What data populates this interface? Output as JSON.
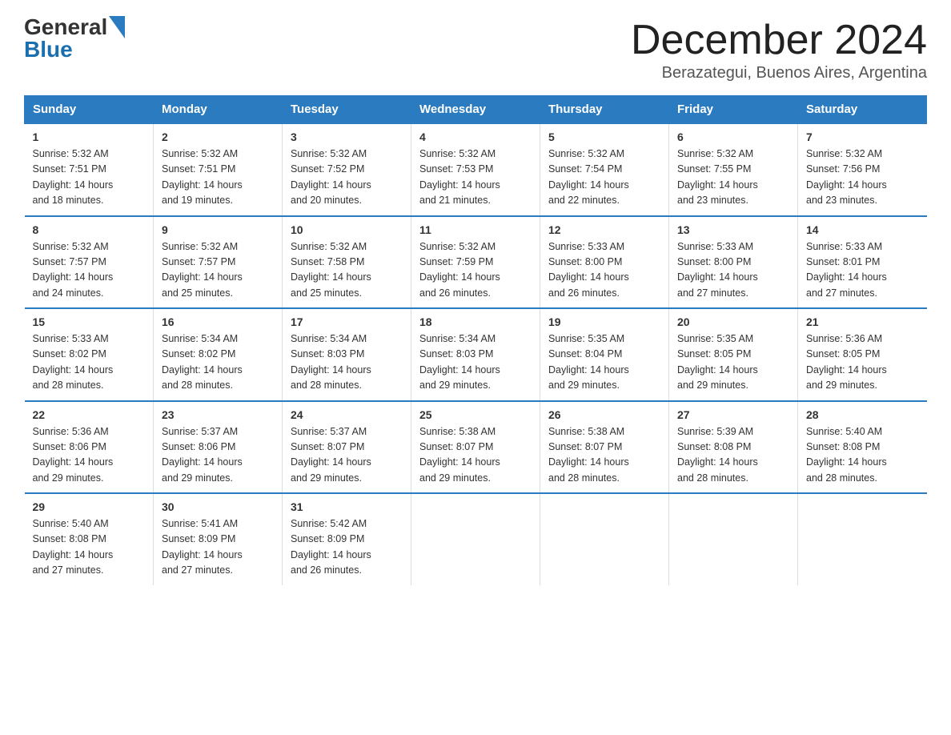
{
  "logo": {
    "general": "General",
    "blue": "Blue"
  },
  "title": "December 2024",
  "subtitle": "Berazategui, Buenos Aires, Argentina",
  "headers": [
    "Sunday",
    "Monday",
    "Tuesday",
    "Wednesday",
    "Thursday",
    "Friday",
    "Saturday"
  ],
  "weeks": [
    [
      {
        "day": "1",
        "sunrise": "5:32 AM",
        "sunset": "7:51 PM",
        "daylight": "14 hours and 18 minutes."
      },
      {
        "day": "2",
        "sunrise": "5:32 AM",
        "sunset": "7:51 PM",
        "daylight": "14 hours and 19 minutes."
      },
      {
        "day": "3",
        "sunrise": "5:32 AM",
        "sunset": "7:52 PM",
        "daylight": "14 hours and 20 minutes."
      },
      {
        "day": "4",
        "sunrise": "5:32 AM",
        "sunset": "7:53 PM",
        "daylight": "14 hours and 21 minutes."
      },
      {
        "day": "5",
        "sunrise": "5:32 AM",
        "sunset": "7:54 PM",
        "daylight": "14 hours and 22 minutes."
      },
      {
        "day": "6",
        "sunrise": "5:32 AM",
        "sunset": "7:55 PM",
        "daylight": "14 hours and 23 minutes."
      },
      {
        "day": "7",
        "sunrise": "5:32 AM",
        "sunset": "7:56 PM",
        "daylight": "14 hours and 23 minutes."
      }
    ],
    [
      {
        "day": "8",
        "sunrise": "5:32 AM",
        "sunset": "7:57 PM",
        "daylight": "14 hours and 24 minutes."
      },
      {
        "day": "9",
        "sunrise": "5:32 AM",
        "sunset": "7:57 PM",
        "daylight": "14 hours and 25 minutes."
      },
      {
        "day": "10",
        "sunrise": "5:32 AM",
        "sunset": "7:58 PM",
        "daylight": "14 hours and 25 minutes."
      },
      {
        "day": "11",
        "sunrise": "5:32 AM",
        "sunset": "7:59 PM",
        "daylight": "14 hours and 26 minutes."
      },
      {
        "day": "12",
        "sunrise": "5:33 AM",
        "sunset": "8:00 PM",
        "daylight": "14 hours and 26 minutes."
      },
      {
        "day": "13",
        "sunrise": "5:33 AM",
        "sunset": "8:00 PM",
        "daylight": "14 hours and 27 minutes."
      },
      {
        "day": "14",
        "sunrise": "5:33 AM",
        "sunset": "8:01 PM",
        "daylight": "14 hours and 27 minutes."
      }
    ],
    [
      {
        "day": "15",
        "sunrise": "5:33 AM",
        "sunset": "8:02 PM",
        "daylight": "14 hours and 28 minutes."
      },
      {
        "day": "16",
        "sunrise": "5:34 AM",
        "sunset": "8:02 PM",
        "daylight": "14 hours and 28 minutes."
      },
      {
        "day": "17",
        "sunrise": "5:34 AM",
        "sunset": "8:03 PM",
        "daylight": "14 hours and 28 minutes."
      },
      {
        "day": "18",
        "sunrise": "5:34 AM",
        "sunset": "8:03 PM",
        "daylight": "14 hours and 29 minutes."
      },
      {
        "day": "19",
        "sunrise": "5:35 AM",
        "sunset": "8:04 PM",
        "daylight": "14 hours and 29 minutes."
      },
      {
        "day": "20",
        "sunrise": "5:35 AM",
        "sunset": "8:05 PM",
        "daylight": "14 hours and 29 minutes."
      },
      {
        "day": "21",
        "sunrise": "5:36 AM",
        "sunset": "8:05 PM",
        "daylight": "14 hours and 29 minutes."
      }
    ],
    [
      {
        "day": "22",
        "sunrise": "5:36 AM",
        "sunset": "8:06 PM",
        "daylight": "14 hours and 29 minutes."
      },
      {
        "day": "23",
        "sunrise": "5:37 AM",
        "sunset": "8:06 PM",
        "daylight": "14 hours and 29 minutes."
      },
      {
        "day": "24",
        "sunrise": "5:37 AM",
        "sunset": "8:07 PM",
        "daylight": "14 hours and 29 minutes."
      },
      {
        "day": "25",
        "sunrise": "5:38 AM",
        "sunset": "8:07 PM",
        "daylight": "14 hours and 29 minutes."
      },
      {
        "day": "26",
        "sunrise": "5:38 AM",
        "sunset": "8:07 PM",
        "daylight": "14 hours and 28 minutes."
      },
      {
        "day": "27",
        "sunrise": "5:39 AM",
        "sunset": "8:08 PM",
        "daylight": "14 hours and 28 minutes."
      },
      {
        "day": "28",
        "sunrise": "5:40 AM",
        "sunset": "8:08 PM",
        "daylight": "14 hours and 28 minutes."
      }
    ],
    [
      {
        "day": "29",
        "sunrise": "5:40 AM",
        "sunset": "8:08 PM",
        "daylight": "14 hours and 27 minutes."
      },
      {
        "day": "30",
        "sunrise": "5:41 AM",
        "sunset": "8:09 PM",
        "daylight": "14 hours and 27 minutes."
      },
      {
        "day": "31",
        "sunrise": "5:42 AM",
        "sunset": "8:09 PM",
        "daylight": "14 hours and 26 minutes."
      },
      {
        "day": "",
        "sunrise": "",
        "sunset": "",
        "daylight": ""
      },
      {
        "day": "",
        "sunrise": "",
        "sunset": "",
        "daylight": ""
      },
      {
        "day": "",
        "sunrise": "",
        "sunset": "",
        "daylight": ""
      },
      {
        "day": "",
        "sunrise": "",
        "sunset": "",
        "daylight": ""
      }
    ]
  ],
  "labels": {
    "sunrise": "Sunrise:",
    "sunset": "Sunset:",
    "daylight": "Daylight:"
  }
}
